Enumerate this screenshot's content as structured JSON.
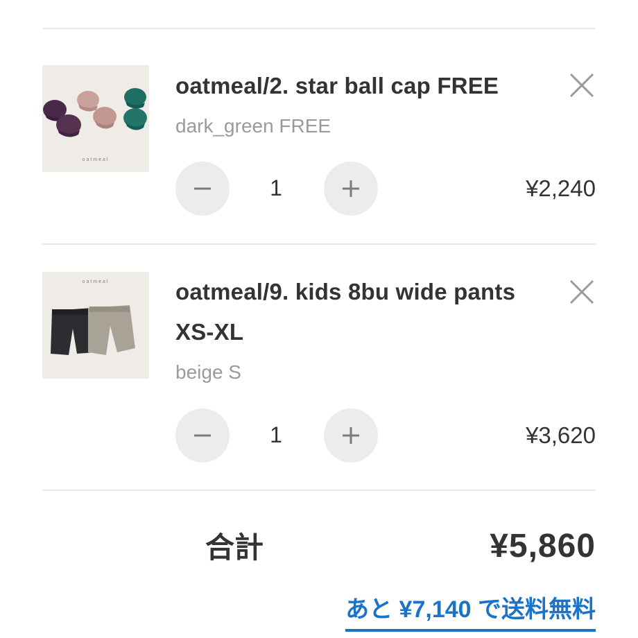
{
  "cart": {
    "items": [
      {
        "title": "oatmeal/2. star ball cap FREE",
        "variant": "dark_green FREE",
        "quantity": "1",
        "price": "¥2,240",
        "image_icon": "product-image-caps",
        "image_brand_text": "oatmeal"
      },
      {
        "title_line1": "oatmeal/9. kids 8bu wide pants",
        "title_line2": "XS-XL",
        "variant": "beige S",
        "quantity": "1",
        "price": "¥3,620",
        "image_icon": "product-image-pants",
        "image_brand_text": "oatmeal"
      }
    ],
    "controls": {
      "decrement_icon": "minus-icon",
      "increment_icon": "plus-icon",
      "remove_icon": "close-icon"
    }
  },
  "summary": {
    "total_label": "合計",
    "total_value": "¥5,860",
    "free_shipping_note": "あと ¥7,140 で送料無料"
  },
  "colors": {
    "text": "#333333",
    "muted": "#9a9a9a",
    "button_bg": "#ececec",
    "divider": "#e9e9e9",
    "link": "#1a73c9"
  }
}
